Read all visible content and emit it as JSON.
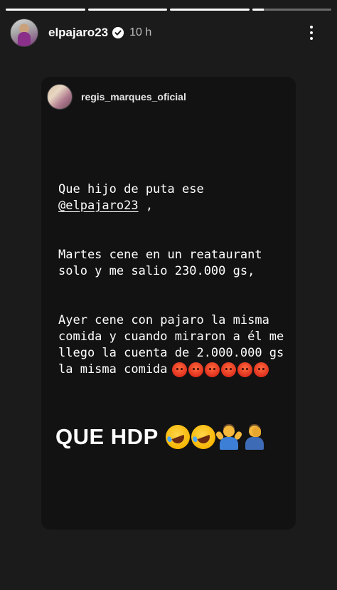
{
  "story": {
    "progress": [
      1,
      1,
      1,
      0.15
    ]
  },
  "header": {
    "username": "elpajaro23",
    "time": "10 h",
    "icons": {
      "verified": "verified-badge-icon",
      "more": "more-vertical-icon"
    }
  },
  "shared_post": {
    "username": "regis_marques_oficial",
    "line1": "Que hijo de puta ese",
    "mention": "@elpajaro23",
    "mention_suffix": " ,",
    "paragraph2": "Martes cene en un reataurant solo y me salio 230.000 gs,",
    "paragraph3": "Ayer cene con pajaro la misma comida y cuando miraron a él me llego la cuenta de 2.000.000 gs la misma comida",
    "angry_emoji_count": 6,
    "big_text": "QUE HDP",
    "big_emojis": [
      "rolling-on-floor-laughing",
      "rolling-on-floor-laughing",
      "person-shrugging",
      "person-facepalming"
    ]
  }
}
